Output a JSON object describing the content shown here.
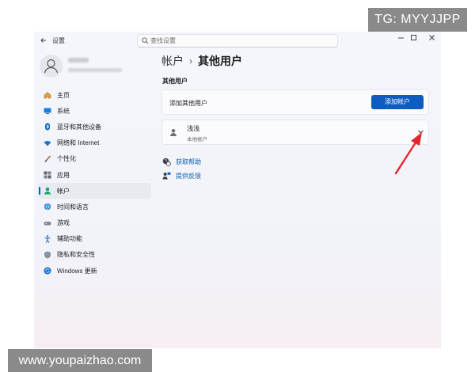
{
  "watermarks": {
    "top_right": "TG: MYYJJPP",
    "bottom_left": "www.youpaizhao.com"
  },
  "titlebar": {
    "app_title": "设置",
    "search_placeholder": "查找设置",
    "controls": {
      "minimize": "—",
      "maximize": "☐",
      "close": "✕"
    }
  },
  "sidebar": {
    "items": [
      {
        "label": "主页",
        "icon": "home-icon"
      },
      {
        "label": "系统",
        "icon": "system-icon"
      },
      {
        "label": "蓝牙和其他设备",
        "icon": "bluetooth-icon"
      },
      {
        "label": "网络和 Internet",
        "icon": "wifi-icon"
      },
      {
        "label": "个性化",
        "icon": "brush-icon"
      },
      {
        "label": "应用",
        "icon": "apps-icon"
      },
      {
        "label": "帐户",
        "icon": "account-icon",
        "selected": true
      },
      {
        "label": "时间和语言",
        "icon": "globe-icon"
      },
      {
        "label": "游戏",
        "icon": "gamepad-icon"
      },
      {
        "label": "辅助功能",
        "icon": "accessibility-icon"
      },
      {
        "label": "隐私和安全性",
        "icon": "shield-icon"
      },
      {
        "label": "Windows 更新",
        "icon": "update-icon"
      }
    ]
  },
  "main": {
    "breadcrumb": {
      "parent": "帐户",
      "separator": "›",
      "current": "其他用户"
    },
    "section_title": "其他用户",
    "add_user": {
      "label": "添加其他用户",
      "button": "添加帐户"
    },
    "user": {
      "name": "浅浅",
      "type": "本地帐户"
    },
    "links": [
      {
        "label": "获取帮助",
        "icon": "help-icon"
      },
      {
        "label": "提供反馈",
        "icon": "feedback-icon"
      }
    ]
  },
  "colors": {
    "accent": "#0f5cc0",
    "link": "#0b5fb8",
    "arrow": "#e5262b"
  }
}
